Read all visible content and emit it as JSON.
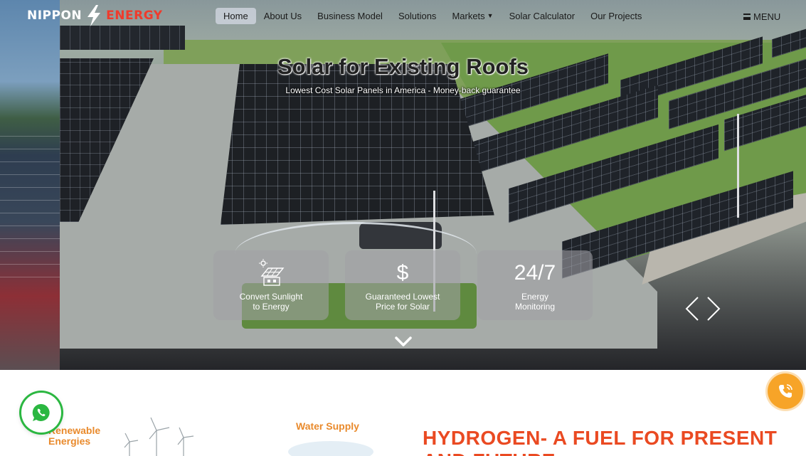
{
  "brand": {
    "name_part1": "NIPPON",
    "name_part2": "ENERGY",
    "accent_color": "#ef3b2c"
  },
  "nav": {
    "items": [
      {
        "label": "Home",
        "active": true
      },
      {
        "label": "About Us"
      },
      {
        "label": "Business Model"
      },
      {
        "label": "Solutions"
      },
      {
        "label": "Markets",
        "has_dropdown": true
      },
      {
        "label": "Solar Calculator"
      },
      {
        "label": "Our Projects"
      }
    ],
    "menu_label": "MENU",
    "menu_icon": "hamburger-icon"
  },
  "hero": {
    "title": "Solar for Existing Roofs",
    "subtitle": "Lowest Cost Solar Panels in America - Money-back guarantee",
    "cards": [
      {
        "icon": "solar-house-icon",
        "label": "Convert Sunlight\nto Energy"
      },
      {
        "icon": "dollar-icon",
        "symbol": "$",
        "label": "Guaranteed Lowest\nPrice for Solar"
      },
      {
        "big_text": "24/7",
        "label": "Energy\nMonitoring"
      }
    ],
    "prev_icon": "chevron-left-icon",
    "next_icon": "chevron-right-icon",
    "scroll_icon": "chevron-down-icon"
  },
  "lower": {
    "categories": [
      {
        "label": "Renewable\nEnergies"
      },
      {
        "label": "Water Supply"
      }
    ],
    "heading": "HYDROGEN- A FUEL FOR PRESENT AND FUTURE",
    "accent_color": "#ea4a22"
  },
  "floating": {
    "whatsapp_icon": "whatsapp-icon",
    "call_icon": "phone-icon",
    "call_color": "#f7a428",
    "whatsapp_color": "#2bb741"
  }
}
